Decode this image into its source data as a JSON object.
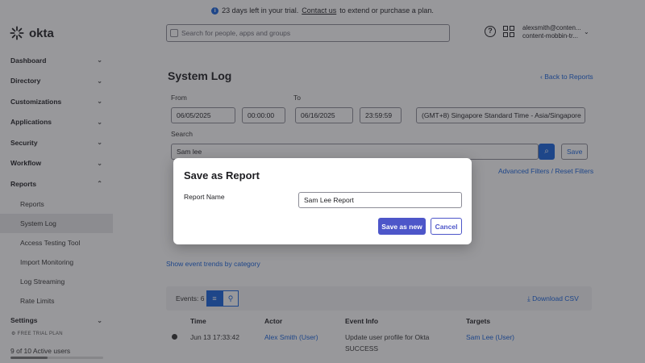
{
  "banner": {
    "text_before": "23 days left in your trial.",
    "link": "Contact us",
    "text_after": "to extend or purchase a plan."
  },
  "brand": {
    "name": "okta"
  },
  "sidebar": {
    "items": [
      {
        "label": "Dashboard"
      },
      {
        "label": "Directory"
      },
      {
        "label": "Customizations"
      },
      {
        "label": "Applications"
      },
      {
        "label": "Security"
      },
      {
        "label": "Workflow"
      },
      {
        "label": "Reports"
      }
    ],
    "reports_sub": [
      {
        "label": "Reports"
      },
      {
        "label": "System Log",
        "active": true
      },
      {
        "label": "Access Testing Tool"
      },
      {
        "label": "Import Monitoring"
      },
      {
        "label": "Log Streaming"
      },
      {
        "label": "Rate Limits"
      }
    ],
    "settings": "Settings",
    "trial_badge": "FREE TRIAL PLAN",
    "users": "9 of 10 Active users",
    "users_fraction": 0.4
  },
  "topbar": {
    "search_placeholder": "Search for people, apps and groups",
    "user_email": "alexsmith@conten...",
    "user_org": "content-mobbin-tr..."
  },
  "page": {
    "title": "System Log",
    "back_link": "Back to Reports",
    "from_label": "From",
    "to_label": "To",
    "from_date": "06/05/2025",
    "from_time": "00:00:00",
    "to_date": "06/16/2025",
    "to_time": "23:59:59",
    "timezone": "(GMT+8) Singapore Standard Time - Asia/Singapore",
    "search_label": "Search",
    "search_value": "Sam lee",
    "save_label": "Save",
    "advanced_filters": "Advanced Filters / Reset Filters",
    "trend_link": "Show event trends by category",
    "events_label": "Events: 6",
    "download_csv": "Download CSV"
  },
  "table": {
    "headers": [
      "Time",
      "Actor",
      "Event Info",
      "Targets"
    ],
    "rows": [
      {
        "time": "Jun 13 17:33:42",
        "actor": "Alex Smith (User)",
        "event": "Update user profile for Okta",
        "status": "SUCCESS",
        "target": "Sam Lee (User)"
      }
    ]
  },
  "modal": {
    "title": "Save as Report",
    "field_label": "Report Name",
    "field_value": "Sam Lee Report",
    "primary_label": "Save as new",
    "secondary_label": "Cancel"
  },
  "colors": {
    "primary": "#4d56c9",
    "link": "#1662dd",
    "overlay": "#28282d"
  }
}
